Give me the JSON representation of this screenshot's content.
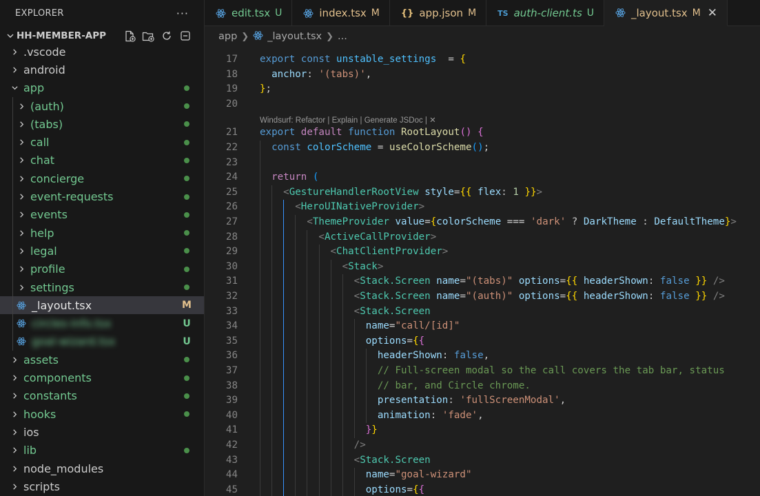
{
  "explorer": {
    "title": "EXPLORER",
    "more": "···",
    "project": "HH-MEMBER-APP",
    "status_colors": {
      "modified": "#e2c08d",
      "untracked": "#73c991",
      "dot": "#4a8f4a"
    },
    "items": [
      {
        "label": ".vscode",
        "kind": "folder",
        "depth": 0,
        "expanded": false,
        "status": ""
      },
      {
        "label": "android",
        "kind": "folder",
        "depth": 0,
        "expanded": false,
        "status": ""
      },
      {
        "label": "app",
        "kind": "folder",
        "depth": 0,
        "expanded": true,
        "status": "dot"
      },
      {
        "label": "(auth)",
        "kind": "folder",
        "depth": 1,
        "expanded": false,
        "status": "dot"
      },
      {
        "label": "(tabs)",
        "kind": "folder",
        "depth": 1,
        "expanded": false,
        "status": "dot"
      },
      {
        "label": "call",
        "kind": "folder",
        "depth": 1,
        "expanded": false,
        "status": "dot"
      },
      {
        "label": "chat",
        "kind": "folder",
        "depth": 1,
        "expanded": false,
        "status": "dot"
      },
      {
        "label": "concierge",
        "kind": "folder",
        "depth": 1,
        "expanded": false,
        "status": "dot"
      },
      {
        "label": "event-requests",
        "kind": "folder",
        "depth": 1,
        "expanded": false,
        "status": "dot"
      },
      {
        "label": "events",
        "kind": "folder",
        "depth": 1,
        "expanded": false,
        "status": "dot"
      },
      {
        "label": "help",
        "kind": "folder",
        "depth": 1,
        "expanded": false,
        "status": "dot"
      },
      {
        "label": "legal",
        "kind": "folder",
        "depth": 1,
        "expanded": false,
        "status": "dot"
      },
      {
        "label": "profile",
        "kind": "folder",
        "depth": 1,
        "expanded": false,
        "status": "dot"
      },
      {
        "label": "settings",
        "kind": "folder",
        "depth": 1,
        "expanded": false,
        "status": "dot"
      },
      {
        "label": "_layout.tsx",
        "kind": "file",
        "depth": 1,
        "status": "M",
        "selected": true
      },
      {
        "label": "circles-info.tsx",
        "kind": "file",
        "depth": 1,
        "status": "U",
        "blurred": true
      },
      {
        "label": "goal-wizard.tsx",
        "kind": "file",
        "depth": 1,
        "status": "U",
        "blurred": true
      },
      {
        "label": "assets",
        "kind": "folder",
        "depth": 0,
        "expanded": false,
        "status": "dot"
      },
      {
        "label": "components",
        "kind": "folder",
        "depth": 0,
        "expanded": false,
        "status": "dot"
      },
      {
        "label": "constants",
        "kind": "folder",
        "depth": 0,
        "expanded": false,
        "status": "dot"
      },
      {
        "label": "hooks",
        "kind": "folder",
        "depth": 0,
        "expanded": false,
        "status": "dot"
      },
      {
        "label": "ios",
        "kind": "folder",
        "depth": 0,
        "expanded": false,
        "status": ""
      },
      {
        "label": "lib",
        "kind": "folder",
        "depth": 0,
        "expanded": false,
        "status": "dot"
      },
      {
        "label": "node_modules",
        "kind": "folder",
        "depth": 0,
        "expanded": false,
        "status": ""
      },
      {
        "label": "scripts",
        "kind": "folder",
        "depth": 0,
        "expanded": false,
        "status": ""
      }
    ]
  },
  "tabs": [
    {
      "label": "edit.tsx",
      "icon": "react-icon",
      "status": "U",
      "italic": false,
      "active": false
    },
    {
      "label": "index.tsx",
      "icon": "react-icon",
      "status": "M",
      "italic": false,
      "active": false
    },
    {
      "label": "app.json",
      "icon": "json-icon",
      "icon_text": "{}",
      "status": "M",
      "italic": false,
      "active": false
    },
    {
      "label": "auth-client.ts",
      "icon": "ts-icon",
      "icon_text": "TS",
      "status": "U",
      "italic": true,
      "active": false
    },
    {
      "label": "_layout.tsx",
      "icon": "react-icon",
      "status": "M",
      "italic": false,
      "active": true
    }
  ],
  "breadcrumb": {
    "folder": "app",
    "file": "_layout.tsx",
    "trail": "..."
  },
  "editor": {
    "codelens": "Windsurf: Refactor | Explain | Generate JSDoc | ✕",
    "lines": [
      {
        "n": "17",
        "tokens": [
          [
            "kw",
            "export "
          ],
          [
            "kw",
            "const "
          ],
          [
            "cst",
            "unstable_settings"
          ],
          [
            "",
            "  = "
          ],
          [
            "br1",
            "{"
          ]
        ]
      },
      {
        "n": "18",
        "tokens": [
          [
            "",
            "  "
          ],
          [
            "var",
            "anchor"
          ],
          [
            "",
            ": "
          ],
          [
            "str",
            "'(tabs)'"
          ],
          [
            "",
            ","
          ]
        ]
      },
      {
        "n": "19",
        "tokens": [
          [
            "br1",
            "}"
          ],
          [
            "",
            ";"
          ]
        ]
      },
      {
        "n": "20",
        "tokens": []
      },
      {
        "n": "21",
        "tokens": [
          [
            "kw",
            "export "
          ],
          [
            "ctl",
            "default "
          ],
          [
            "kw",
            "function "
          ],
          [
            "fn",
            "RootLayout"
          ],
          [
            "br2",
            "()"
          ],
          [
            "",
            ""
          ],
          [
            "br2",
            " {"
          ]
        ]
      },
      {
        "n": "22",
        "tokens": [
          [
            "",
            "  "
          ],
          [
            "kw",
            "const "
          ],
          [
            "cst",
            "colorScheme"
          ],
          [
            "",
            " = "
          ],
          [
            "fn",
            "useColorScheme"
          ],
          [
            "br3",
            "()"
          ],
          [
            "",
            ";"
          ]
        ]
      },
      {
        "n": "23",
        "tokens": []
      },
      {
        "n": "24",
        "tokens": [
          [
            "",
            "  "
          ],
          [
            "ctl",
            "return "
          ],
          [
            "br3",
            "("
          ]
        ]
      },
      {
        "n": "25",
        "tokens": [
          [
            "",
            "    "
          ],
          [
            "pn",
            "<"
          ],
          [
            "tag",
            "GestureHandlerRootView"
          ],
          [
            "",
            " "
          ],
          [
            "var",
            "style"
          ],
          [
            "",
            "="
          ],
          [
            "br1",
            "{{"
          ],
          [
            "",
            " "
          ],
          [
            "var",
            "flex"
          ],
          [
            "",
            ": "
          ],
          [
            "num",
            "1"
          ],
          [
            "",
            " "
          ],
          [
            "br1",
            "}}"
          ],
          [
            "pn",
            ">"
          ]
        ]
      },
      {
        "n": "26",
        "tokens": [
          [
            "",
            "      "
          ],
          [
            "pn",
            "<"
          ],
          [
            "tag",
            "HeroUINativeProvider"
          ],
          [
            "pn",
            ">"
          ]
        ]
      },
      {
        "n": "27",
        "tokens": [
          [
            "",
            "        "
          ],
          [
            "pn",
            "<"
          ],
          [
            "tag",
            "ThemeProvider"
          ],
          [
            "",
            " "
          ],
          [
            "var",
            "value"
          ],
          [
            "",
            "="
          ],
          [
            "br1",
            "{"
          ],
          [
            "var",
            "colorScheme"
          ],
          [
            "",
            " === "
          ],
          [
            "str",
            "'dark'"
          ],
          [
            "",
            " ? "
          ],
          [
            "var",
            "DarkTheme"
          ],
          [
            "",
            " : "
          ],
          [
            "var",
            "DefaultTheme"
          ],
          [
            "br1",
            "}"
          ],
          [
            "pn",
            ">"
          ]
        ]
      },
      {
        "n": "28",
        "tokens": [
          [
            "",
            "          "
          ],
          [
            "pn",
            "<"
          ],
          [
            "tag",
            "ActiveCallProvider"
          ],
          [
            "pn",
            ">"
          ]
        ]
      },
      {
        "n": "29",
        "tokens": [
          [
            "",
            "            "
          ],
          [
            "pn",
            "<"
          ],
          [
            "tag",
            "ChatClientProvider"
          ],
          [
            "pn",
            ">"
          ]
        ]
      },
      {
        "n": "30",
        "tokens": [
          [
            "",
            "              "
          ],
          [
            "pn",
            "<"
          ],
          [
            "tag",
            "Stack"
          ],
          [
            "pn",
            ">"
          ]
        ]
      },
      {
        "n": "31",
        "tokens": [
          [
            "",
            "                "
          ],
          [
            "pn",
            "<"
          ],
          [
            "tag",
            "Stack.Screen"
          ],
          [
            "",
            " "
          ],
          [
            "var",
            "name"
          ],
          [
            "",
            "="
          ],
          [
            "str",
            "\"(tabs)\""
          ],
          [
            "",
            " "
          ],
          [
            "var",
            "options"
          ],
          [
            "",
            "="
          ],
          [
            "br1",
            "{{"
          ],
          [
            "",
            " "
          ],
          [
            "var",
            "headerShown"
          ],
          [
            "",
            ": "
          ],
          [
            "kw",
            "false"
          ],
          [
            "",
            " "
          ],
          [
            "br1",
            "}}"
          ],
          [
            "pn",
            " />"
          ]
        ]
      },
      {
        "n": "32",
        "tokens": [
          [
            "",
            "                "
          ],
          [
            "pn",
            "<"
          ],
          [
            "tag",
            "Stack.Screen"
          ],
          [
            "",
            " "
          ],
          [
            "var",
            "name"
          ],
          [
            "",
            "="
          ],
          [
            "str",
            "\"(auth)\""
          ],
          [
            "",
            " "
          ],
          [
            "var",
            "options"
          ],
          [
            "",
            "="
          ],
          [
            "br1",
            "{{"
          ],
          [
            "",
            " "
          ],
          [
            "var",
            "headerShown"
          ],
          [
            "",
            ": "
          ],
          [
            "kw",
            "false"
          ],
          [
            "",
            " "
          ],
          [
            "br1",
            "}}"
          ],
          [
            "pn",
            " />"
          ]
        ]
      },
      {
        "n": "33",
        "tokens": [
          [
            "",
            "                "
          ],
          [
            "pn",
            "<"
          ],
          [
            "tag",
            "Stack.Screen"
          ]
        ]
      },
      {
        "n": "34",
        "tokens": [
          [
            "",
            "                  "
          ],
          [
            "var",
            "name"
          ],
          [
            "",
            "="
          ],
          [
            "str",
            "\"call/[id]\""
          ]
        ]
      },
      {
        "n": "35",
        "tokens": [
          [
            "",
            "                  "
          ],
          [
            "var",
            "options"
          ],
          [
            "",
            "="
          ],
          [
            "br1",
            "{"
          ],
          [
            "br2",
            "{"
          ]
        ]
      },
      {
        "n": "36",
        "tokens": [
          [
            "",
            "                    "
          ],
          [
            "var",
            "headerShown"
          ],
          [
            "",
            ": "
          ],
          [
            "kw",
            "false"
          ],
          [
            "",
            ","
          ]
        ]
      },
      {
        "n": "37",
        "tokens": [
          [
            "",
            "                    "
          ],
          [
            "cm",
            "// Full-screen modal so the call covers the tab bar, status"
          ]
        ]
      },
      {
        "n": "38",
        "tokens": [
          [
            "",
            "                    "
          ],
          [
            "cm",
            "// bar, and Circle chrome."
          ]
        ]
      },
      {
        "n": "39",
        "tokens": [
          [
            "",
            "                    "
          ],
          [
            "var",
            "presentation"
          ],
          [
            "",
            ": "
          ],
          [
            "str",
            "'fullScreenModal'"
          ],
          [
            "",
            ","
          ]
        ]
      },
      {
        "n": "40",
        "tokens": [
          [
            "",
            "                    "
          ],
          [
            "var",
            "animation"
          ],
          [
            "",
            ": "
          ],
          [
            "str",
            "'fade'"
          ],
          [
            "",
            ","
          ]
        ]
      },
      {
        "n": "41",
        "tokens": [
          [
            "",
            "                  "
          ],
          [
            "br2",
            "}"
          ],
          [
            "br1",
            "}"
          ]
        ]
      },
      {
        "n": "42",
        "tokens": [
          [
            "",
            "                "
          ],
          [
            "pn",
            "/>"
          ]
        ]
      },
      {
        "n": "43",
        "tokens": [
          [
            "",
            "                "
          ],
          [
            "pn",
            "<"
          ],
          [
            "tag",
            "Stack.Screen"
          ]
        ]
      },
      {
        "n": "44",
        "tokens": [
          [
            "",
            "                  "
          ],
          [
            "var",
            "name"
          ],
          [
            "",
            "="
          ],
          [
            "str",
            "\"goal-wizard\""
          ]
        ]
      },
      {
        "n": "45",
        "tokens": [
          [
            "",
            "                  "
          ],
          [
            "var",
            "options"
          ],
          [
            "",
            "="
          ],
          [
            "br1",
            "{"
          ],
          [
            "br2",
            "{"
          ]
        ]
      }
    ]
  }
}
